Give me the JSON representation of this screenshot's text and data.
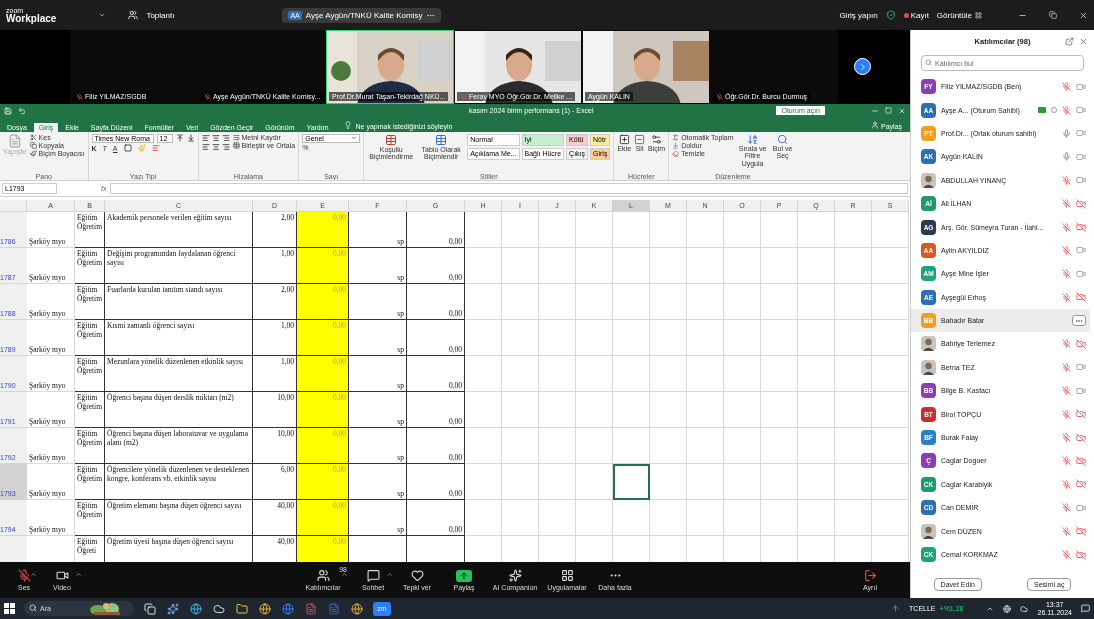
{
  "top_bar": {
    "logo_top": "zoom",
    "logo_bottom": "Workplace",
    "meeting_menu": "Toplantı",
    "meeting_pill": {
      "initials": "AA",
      "name": "Ayşe Aygün/TNKÜ Kalite Komisy"
    },
    "sign_in": "Giriş yapın",
    "recording": "Kayıt",
    "view": "Görüntüle"
  },
  "video_strip": [
    {
      "name": "Filiz YILMAZ/SGDB",
      "muted": true,
      "kind": "blank",
      "active": false
    },
    {
      "name": "Ayşe Aygün/TNKÜ Kalite Komisy...",
      "muted": true,
      "kind": "blank",
      "active": false
    },
    {
      "name": "Prof.Dr.Murat Taşan-Tekirdağ NKÜ...",
      "muted": false,
      "kind": "office",
      "active": true
    },
    {
      "name": "Feray MYO Öğr.Gör.Dr. Melike ...",
      "muted": true,
      "kind": "room",
      "active": false
    },
    {
      "name": "Aygün KALIN",
      "muted": false,
      "kind": "home",
      "active": false
    },
    {
      "name": "Öğr.Gör.Dr. Burcu Durmuş",
      "muted": true,
      "kind": "blank",
      "active": false
    }
  ],
  "excel": {
    "title": "kasım 2024 birim performans (1) - Excel",
    "sign_in": "Oturum açın",
    "share": "Paylaş",
    "tabs": [
      {
        "label": "Dosya",
        "selected": false
      },
      {
        "label": "Giriş",
        "selected": true
      },
      {
        "label": "Ekle",
        "selected": false
      },
      {
        "label": "Sayfa Düzeni",
        "selected": false
      },
      {
        "label": "Formüller",
        "selected": false
      },
      {
        "label": "Veri",
        "selected": false
      },
      {
        "label": "Gözden Geçir",
        "selected": false
      },
      {
        "label": "Görünüm",
        "selected": false
      },
      {
        "label": "Yardım",
        "selected": false
      }
    ],
    "tell_me": "Ne yapmak istediğinizi söyleyin",
    "ribbon": {
      "paste": "Yapıştır",
      "cut": "Kes",
      "copy": "Kopyala",
      "format_painter": "Biçim Boyacısı",
      "clipboard": "Pano",
      "font_name": "Times New Roma",
      "font_size": "12",
      "bold": "K",
      "italic": "T",
      "underline": "A",
      "font": "Yazı Tipi",
      "wrap": "Metni Kaydır",
      "merge": "Birleştir ve Ortala",
      "alignment": "Hizalama",
      "number_format": "Genel",
      "percent": "%",
      "number": "Sayı",
      "conditional": "Koşullu Biçimlendirme",
      "as_table": "Tablo Olarak Biçimlendir",
      "styles": [
        {
          "label": "Normal",
          "color": "#ffffff"
        },
        {
          "label": "İyi",
          "color": "#c6efce"
        },
        {
          "label": "Kötü",
          "color": "#ffc7ce"
        },
        {
          "label": "Nötr",
          "color": "#ffeb9c"
        },
        {
          "label": "Açıklama Me...",
          "color": "#ffffff"
        },
        {
          "label": "Bağlı Hücre",
          "color": "#ffffff"
        },
        {
          "label": "Çıkış",
          "color": "#f2f2f2"
        },
        {
          "label": "Giriş",
          "color": "#ffcc99"
        }
      ],
      "styles_group": "Stiller",
      "insert": "Ekle",
      "delete": "Sil",
      "format": "Biçim",
      "cells": "Hücreler",
      "autosum": "Otomatik Toplam",
      "fill": "Doldur",
      "clear": "Temizle",
      "sort": "Sırala ve Filtre Uygula",
      "find": "Bul ve Seç",
      "editing": "Düzenleme"
    },
    "name_box": "L1793",
    "fx": "fx",
    "columns": [
      {
        "label": "A",
        "selected": false
      },
      {
        "label": "B",
        "selected": false
      },
      {
        "label": "C",
        "selected": false
      },
      {
        "label": "D",
        "selected": false
      },
      {
        "label": "E",
        "selected": false
      },
      {
        "label": "F",
        "selected": false
      },
      {
        "label": "G",
        "selected": false
      },
      {
        "label": "H",
        "selected": false
      },
      {
        "label": "I",
        "selected": false
      },
      {
        "label": "J",
        "selected": false
      },
      {
        "label": "K",
        "selected": false
      },
      {
        "label": "L",
        "selected": true
      },
      {
        "label": "M",
        "selected": false
      },
      {
        "label": "N",
        "selected": false
      },
      {
        "label": "O",
        "selected": false
      },
      {
        "label": "P",
        "selected": false
      },
      {
        "label": "Q",
        "selected": false
      },
      {
        "label": "R",
        "selected": false
      },
      {
        "label": "S",
        "selected": false
      }
    ],
    "rows": [
      {
        "number": "1786",
        "selected": false,
        "a": "Şarköy myo",
        "b": "Eğitim Öğretim",
        "c": "Akademik personele verilen eğitim sayısı",
        "d": "2,00",
        "e": "0,00",
        "f": "sp",
        "g": "0,00"
      },
      {
        "number": "1787",
        "selected": false,
        "a": "Şarköy myo",
        "b": "Eğitim Öğretim",
        "c": "Değişim programından faydalanan öğrenci sayısı",
        "d": "1,00",
        "e": "0,00",
        "f": "sp",
        "g": "0,00"
      },
      {
        "number": "1788",
        "selected": false,
        "a": "Şarköy myo",
        "b": "Eğitim Öğretim",
        "c": "Fuarlarda kurulan tanıtım standı sayısı",
        "d": "2,00",
        "e": "0,00",
        "f": "sp",
        "g": "0,00"
      },
      {
        "number": "1789",
        "selected": false,
        "a": "Şarköy myo",
        "b": "Eğitim Öğretim",
        "c": "Kısmi zamanlı öğrenci sayısı",
        "d": "1,00",
        "e": "0,00",
        "f": "sp",
        "g": "0,00"
      },
      {
        "number": "1790",
        "selected": false,
        "a": "Şarköy myo",
        "b": "Eğitim Öğretim",
        "c": "Mezunlara yönelik düzenlenen etkinlik sayısı",
        "d": "1,00",
        "e": "0,00",
        "f": "sp",
        "g": "0,00"
      },
      {
        "number": "1791",
        "selected": false,
        "a": "Şarköy myo",
        "b": "Eğitim Öğretim",
        "c": "Öğrenci başına düşen derslik miktarı (m2)",
        "d": "10,00",
        "e": "0,00",
        "f": "sp",
        "g": "0,00"
      },
      {
        "number": "1792",
        "selected": false,
        "a": "Şarköy myo",
        "b": "Eğitim Öğretim",
        "c": "Öğrenci başına düşen laboratuvar ve uygulama alanı (m2)",
        "d": "10,00",
        "e": "0,00",
        "f": "sp",
        "g": "0,00"
      },
      {
        "number": "1793",
        "selected": true,
        "a": "Şarköy myo",
        "b": "Eğitim Öğretim",
        "c": "Öğrencilere yönelik düzenlenen ve desteklenen kongre, konferans vb. etkinlik sayısı",
        "d": "6,00",
        "e": "0,00",
        "f": "sp",
        "g": "0,00"
      },
      {
        "number": "1794",
        "selected": false,
        "a": "Şarköy myo",
        "b": "Eğitim Öğretim",
        "c": "Öğretim elemanı başına düşen öğrenci sayısı",
        "d": "40,00",
        "e": "0,00",
        "f": "sp",
        "g": "0,00"
      },
      {
        "selected": false,
        "b": "Eğitim Öğreti",
        "c": "Öğretim üyesi başına düşen öğrenci sayısı",
        "d": "40,00",
        "e": "0,00"
      }
    ]
  },
  "participants": {
    "title": "Katılımcılar (98)",
    "search": {
      "placeholder": "Katılımcı bul"
    },
    "items": [
      {
        "initials": "FY",
        "color": "#8a3db6",
        "name": "Filiz YILMAZ/SGDB (Ben)",
        "kind": "initials",
        "muted": true,
        "video_blocked": false
      },
      {
        "initials": "AA",
        "color": "#2d6fb3",
        "name": "Ayşe A... (Oturum Sahibi)",
        "kind": "initials",
        "badge": true,
        "muted": true,
        "video_blocked": false
      },
      {
        "initials": "PT",
        "color": "#f0a020",
        "name": "Prof.Dr...   (Ortak oturum sahibi)",
        "kind": "initials",
        "muted": false,
        "video_blocked": false
      },
      {
        "initials": "AK",
        "color": "#2d6fb3",
        "name": "Aygün KALIN",
        "kind": "initials",
        "muted": false,
        "video_blocked": false
      },
      {
        "name": "ABDULLAH YINANÇ",
        "muted": true,
        "video_blocked": false
      },
      {
        "initials": "Aİ",
        "color": "#1f9a6a",
        "name": "Ali İLHAN",
        "kind": "initials",
        "muted": true,
        "video_blocked": true
      },
      {
        "initials": "AG",
        "color": "#2b3a4e",
        "name": "Arş. Gör. Sümeyra Turan - İlahi...",
        "kind": "initials",
        "muted": true,
        "video_blocked": true
      },
      {
        "initials": "AA",
        "color": "#d9581c",
        "name": "Aylin AKYILDIZ",
        "kind": "initials",
        "muted": true,
        "video_blocked": false
      },
      {
        "initials": "AM",
        "color": "#1fa37e",
        "name": "Ayşe Mine İşler",
        "kind": "initials",
        "muted": true,
        "video_blocked": false
      },
      {
        "initials": "AE",
        "color": "#2d6fb3",
        "name": "Ayşegül Erhoş",
        "kind": "initials",
        "muted": true,
        "video_blocked": true
      },
      {
        "initials": "BB",
        "color": "#f0a020",
        "name": "Bahadır Batar",
        "kind": "initials",
        "highlighted": true
      },
      {
        "name": "Bahriye Terlemez",
        "muted": true,
        "video_blocked": true
      },
      {
        "name": "Berna TEZ",
        "muted": true,
        "video_blocked": false
      },
      {
        "initials": "BB",
        "color": "#8a3db6",
        "name": "Bilge B. Kastacı",
        "kind": "initials",
        "muted": true,
        "video_blocked": false
      },
      {
        "initials": "BT",
        "color": "#c62f2f",
        "name": "Birol TOPÇU",
        "kind": "initials",
        "muted": true,
        "video_blocked": true
      },
      {
        "initials": "BF",
        "color": "#2d7fc4",
        "name": "Burak Falay",
        "kind": "initials",
        "muted": true,
        "video_blocked": true
      },
      {
        "initials": "Ç",
        "color": "#8a3db6",
        "name": "Caglar Doguer",
        "kind": "initials",
        "muted": true,
        "video_blocked": true
      },
      {
        "initials": "CK",
        "color": "#1f9a6a",
        "name": "Caglar Karabiyik",
        "kind": "initials",
        "muted": true,
        "video_blocked": true
      },
      {
        "initials": "CD",
        "color": "#2d6fb3",
        "name": "Can DEMİR",
        "kind": "initials",
        "muted": true,
        "video_blocked": false
      },
      {
        "name": "Cem DÜZEN",
        "muted": true,
        "video_blocked": true
      },
      {
        "initials": "CK",
        "color": "#1fa37e",
        "name": "Cemal KORKMAZ",
        "kind": "initials",
        "muted": true,
        "video_blocked": true
      }
    ],
    "buttons": [
      "Davet Edin",
      "Sesimi aç"
    ]
  },
  "toolbar": [
    {
      "kind": "audio",
      "label": "Ses",
      "muted": true
    },
    {
      "kind": "video",
      "label": "Video"
    },
    {
      "kind": "participants",
      "label": "Katılımcılar",
      "count": "98"
    },
    {
      "kind": "chat",
      "label": "Sohbet"
    },
    {
      "kind": "react",
      "label": "Tepki ver"
    },
    {
      "kind": "share",
      "label": "Paylaş"
    },
    {
      "kind": "ai",
      "label": "AI Companion"
    },
    {
      "kind": "apps",
      "label": "Uygulamalar"
    },
    {
      "kind": "more",
      "label": "Daha fazla"
    },
    {
      "kind": "leave",
      "label": "Ayrıl"
    }
  ],
  "taskbar": {
    "search": {
      "placeholder": "Ara"
    },
    "apps": [
      {
        "kind": "taskview"
      },
      {
        "kind": "copilot"
      },
      {
        "kind": "browser"
      },
      {
        "kind": "cloud"
      },
      {
        "kind": "folder"
      },
      {
        "kind": "chrome"
      },
      {
        "kind": "ie"
      },
      {
        "kind": "pdf"
      },
      {
        "kind": "word"
      },
      {
        "kind": "chrome"
      },
      {
        "kind": "zoom",
        "label": "zm"
      }
    ],
    "stock": "TCELLE",
    "change": "+%1,28",
    "time": "13:37",
    "date": "26.11.2024"
  }
}
